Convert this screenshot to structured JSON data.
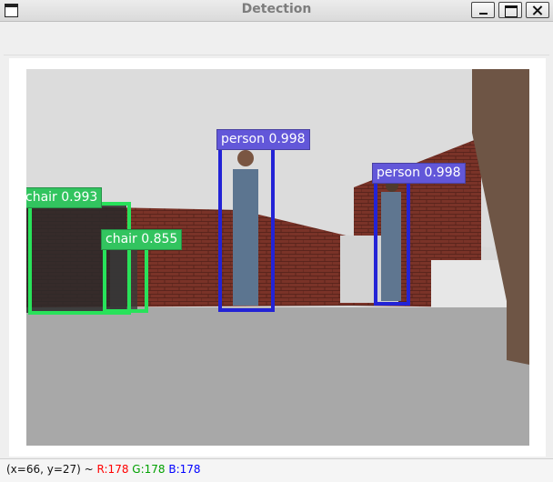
{
  "window": {
    "title": "Detection"
  },
  "detections": [
    {
      "label": "chair",
      "score": "0.993",
      "text": "chair 0.993"
    },
    {
      "label": "chair",
      "score": "0.855",
      "text": "chair 0.855"
    },
    {
      "label": "person",
      "score": "0.998",
      "text": "person 0.998"
    },
    {
      "label": "person",
      "score": "0.998",
      "text": "person 0.998"
    }
  ],
  "status": {
    "coords": "(x=66, y=27) ~",
    "r": "R:178",
    "g": "G:178",
    "b": "B:178"
  },
  "colors": {
    "person_box": "#2323d6",
    "chair_box": "#28e25a",
    "person_label": "#6257d9",
    "chair_label": "#32c45f"
  }
}
